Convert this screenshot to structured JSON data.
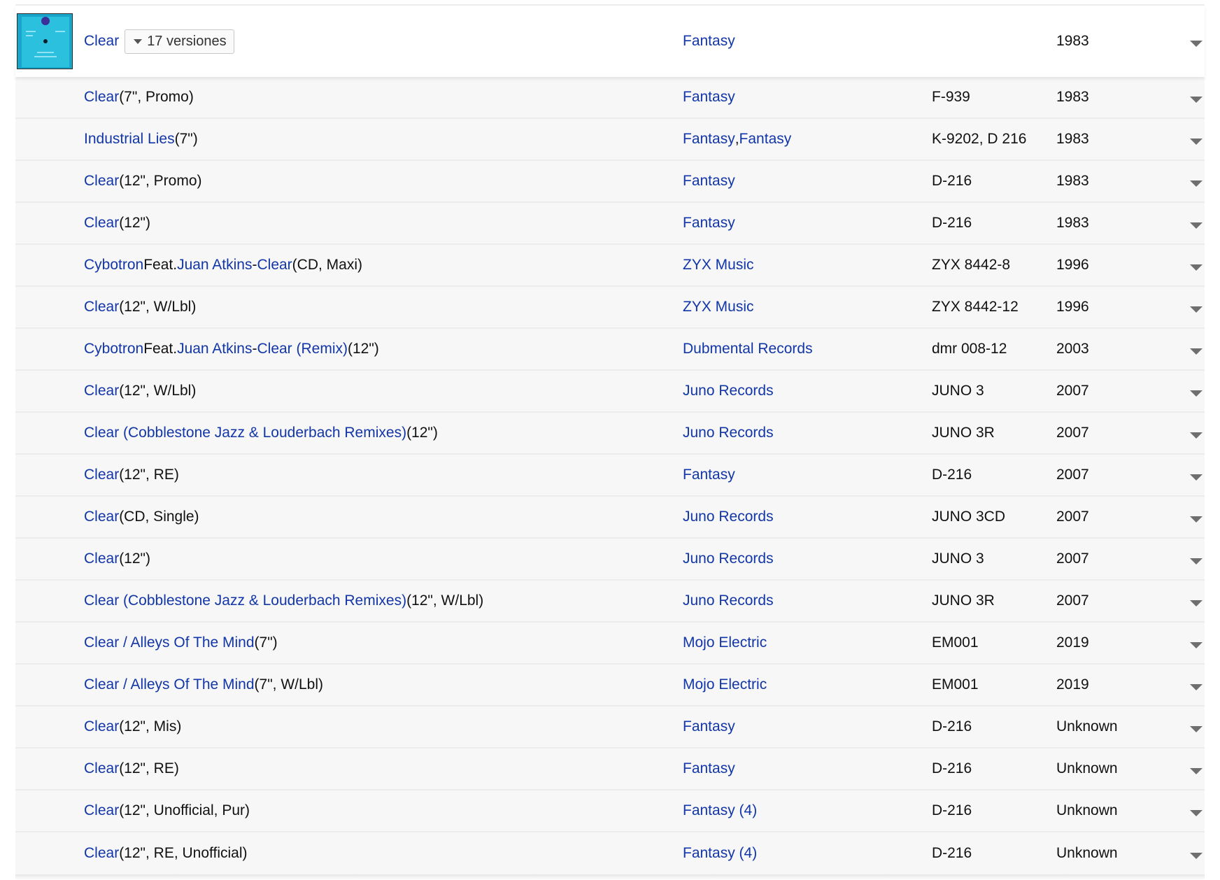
{
  "master": {
    "title": "Clear",
    "versions_label": "17 versiones",
    "label": "Fantasy",
    "catno": "",
    "year": "1983",
    "thumbnail_icon": "record-cover-thumbnail",
    "menu_icon": "caret-down-icon"
  },
  "releases": [
    {
      "title": [
        {
          "text": "Clear",
          "link": true
        },
        {
          "text": " (7\", Promo)",
          "link": false
        }
      ],
      "label": [
        {
          "text": "Fantasy",
          "link": true
        }
      ],
      "catno": "F-939",
      "year": "1983"
    },
    {
      "title": [
        {
          "text": "Industrial Lies",
          "link": true
        },
        {
          "text": " (7\")",
          "link": false
        }
      ],
      "label": [
        {
          "text": "Fantasy",
          "link": true
        },
        {
          "text": ", ",
          "link": false
        },
        {
          "text": "Fantasy",
          "link": true
        }
      ],
      "catno": "K-9202, D 216",
      "year": "1983"
    },
    {
      "title": [
        {
          "text": "Clear",
          "link": true
        },
        {
          "text": " (12\", Promo)",
          "link": false
        }
      ],
      "label": [
        {
          "text": "Fantasy",
          "link": true
        }
      ],
      "catno": "D-216",
      "year": "1983"
    },
    {
      "title": [
        {
          "text": "Clear",
          "link": true
        },
        {
          "text": " (12\")",
          "link": false
        }
      ],
      "label": [
        {
          "text": "Fantasy",
          "link": true
        }
      ],
      "catno": "D-216",
      "year": "1983"
    },
    {
      "title": [
        {
          "text": "Cybotron",
          "link": true
        },
        {
          "text": " Feat. ",
          "link": false
        },
        {
          "text": "Juan Atkins",
          "link": true
        },
        {
          "text": " - ",
          "link": false
        },
        {
          "text": "Clear",
          "link": true
        },
        {
          "text": " (CD, Maxi)",
          "link": false
        }
      ],
      "label": [
        {
          "text": "ZYX Music",
          "link": true
        }
      ],
      "catno": "ZYX 8442-8",
      "year": "1996"
    },
    {
      "title": [
        {
          "text": "Clear",
          "link": true
        },
        {
          "text": " (12\", W/Lbl)",
          "link": false
        }
      ],
      "label": [
        {
          "text": "ZYX Music",
          "link": true
        }
      ],
      "catno": "ZYX 8442-12",
      "year": "1996"
    },
    {
      "title": [
        {
          "text": "Cybotron",
          "link": true
        },
        {
          "text": " Feat. ",
          "link": false
        },
        {
          "text": "Juan Atkins",
          "link": true
        },
        {
          "text": " - ",
          "link": false
        },
        {
          "text": "Clear (Remix)",
          "link": true
        },
        {
          "text": " (12\")",
          "link": false
        }
      ],
      "label": [
        {
          "text": "Dubmental Records",
          "link": true
        }
      ],
      "catno": "dmr 008-12",
      "year": "2003"
    },
    {
      "title": [
        {
          "text": "Clear",
          "link": true
        },
        {
          "text": " (12\", W/Lbl)",
          "link": false
        }
      ],
      "label": [
        {
          "text": "Juno Records",
          "link": true
        }
      ],
      "catno": "JUNO 3",
      "year": "2007"
    },
    {
      "title": [
        {
          "text": "Clear (Cobblestone Jazz & Louderbach Remixes)",
          "link": true
        },
        {
          "text": " (12\")",
          "link": false
        }
      ],
      "label": [
        {
          "text": "Juno Records",
          "link": true
        }
      ],
      "catno": "JUNO 3R",
      "year": "2007"
    },
    {
      "title": [
        {
          "text": "Clear",
          "link": true
        },
        {
          "text": " (12\", RE)",
          "link": false
        }
      ],
      "label": [
        {
          "text": "Fantasy",
          "link": true
        }
      ],
      "catno": "D-216",
      "year": "2007"
    },
    {
      "title": [
        {
          "text": "Clear",
          "link": true
        },
        {
          "text": " (CD, Single)",
          "link": false
        }
      ],
      "label": [
        {
          "text": "Juno Records",
          "link": true
        }
      ],
      "catno": "JUNO 3CD",
      "year": "2007"
    },
    {
      "title": [
        {
          "text": "Clear",
          "link": true
        },
        {
          "text": " (12\")",
          "link": false
        }
      ],
      "label": [
        {
          "text": "Juno Records",
          "link": true
        }
      ],
      "catno": "JUNO 3",
      "year": "2007"
    },
    {
      "title": [
        {
          "text": "Clear (Cobblestone Jazz & Louderbach Remixes)",
          "link": true
        },
        {
          "text": " (12\", W/Lbl)",
          "link": false
        }
      ],
      "label": [
        {
          "text": "Juno Records",
          "link": true
        }
      ],
      "catno": "JUNO 3R",
      "year": "2007"
    },
    {
      "title": [
        {
          "text": "Clear / Alleys Of The Mind",
          "link": true
        },
        {
          "text": " (7\")",
          "link": false
        }
      ],
      "label": [
        {
          "text": "Mojo Electric",
          "link": true
        }
      ],
      "catno": "EM001",
      "year": "2019"
    },
    {
      "title": [
        {
          "text": "Clear / Alleys Of The Mind",
          "link": true
        },
        {
          "text": " (7\", W/Lbl)",
          "link": false
        }
      ],
      "label": [
        {
          "text": "Mojo Electric",
          "link": true
        }
      ],
      "catno": "EM001",
      "year": "2019"
    },
    {
      "title": [
        {
          "text": "Clear",
          "link": true
        },
        {
          "text": " (12\", Mis)",
          "link": false
        }
      ],
      "label": [
        {
          "text": "Fantasy",
          "link": true
        }
      ],
      "catno": "D-216",
      "year": "Unknown"
    },
    {
      "title": [
        {
          "text": "Clear",
          "link": true
        },
        {
          "text": " (12\", RE)",
          "link": false
        }
      ],
      "label": [
        {
          "text": "Fantasy",
          "link": true
        }
      ],
      "catno": "D-216",
      "year": "Unknown"
    },
    {
      "title": [
        {
          "text": "Clear",
          "link": true
        },
        {
          "text": " (12\", Unofficial, Pur)",
          "link": false
        }
      ],
      "label": [
        {
          "text": "Fantasy (4)",
          "link": true
        }
      ],
      "catno": "D-216",
      "year": "Unknown"
    },
    {
      "title": [
        {
          "text": "Clear",
          "link": true
        },
        {
          "text": " (12\", RE, Unofficial)",
          "link": false
        }
      ],
      "label": [
        {
          "text": "Fantasy (4)",
          "link": true
        }
      ],
      "catno": "D-216",
      "year": "Unknown"
    }
  ],
  "colors": {
    "link": "#1236a8",
    "text": "#111111",
    "row_bg": "#f7f7f7",
    "divider": "#ececec"
  }
}
